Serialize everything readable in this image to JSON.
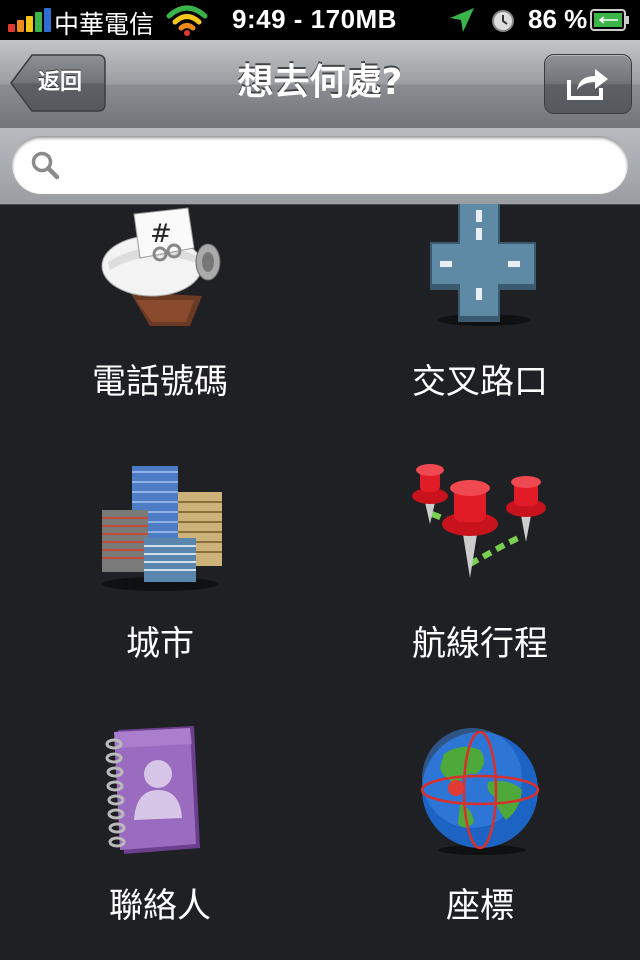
{
  "status_bar": {
    "carrier": "中華電信",
    "time_memory": "9:49 - 170MB",
    "battery": "86 %",
    "icons": [
      "signal-bars-icon",
      "wifi-icon",
      "location-arrow-icon",
      "alarm-clock-icon",
      "battery-icon"
    ]
  },
  "nav": {
    "back_label": "返回",
    "title": "想去何處?",
    "share_icon": "share-arrow-icon"
  },
  "search": {
    "value": "",
    "placeholder": "",
    "icon": "search-icon"
  },
  "menu": {
    "items": [
      {
        "label": "電話號碼",
        "icon": "rolodex-icon"
      },
      {
        "label": "交叉路口",
        "icon": "intersection-icon"
      },
      {
        "label": "城市",
        "icon": "city-buildings-icon"
      },
      {
        "label": "航線行程",
        "icon": "route-pins-icon"
      },
      {
        "label": "聯絡人",
        "icon": "address-book-icon"
      },
      {
        "label": "座標",
        "icon": "globe-coordinates-icon"
      }
    ]
  },
  "colors": {
    "background": "#1f2023",
    "navbar_top": "#c3c5c8",
    "navbar_bottom": "#72757a",
    "label_text": "#ffffff",
    "signal_green": "#3ab54a",
    "signal_red": "#e03a2f",
    "signal_yellow": "#f5c518"
  }
}
